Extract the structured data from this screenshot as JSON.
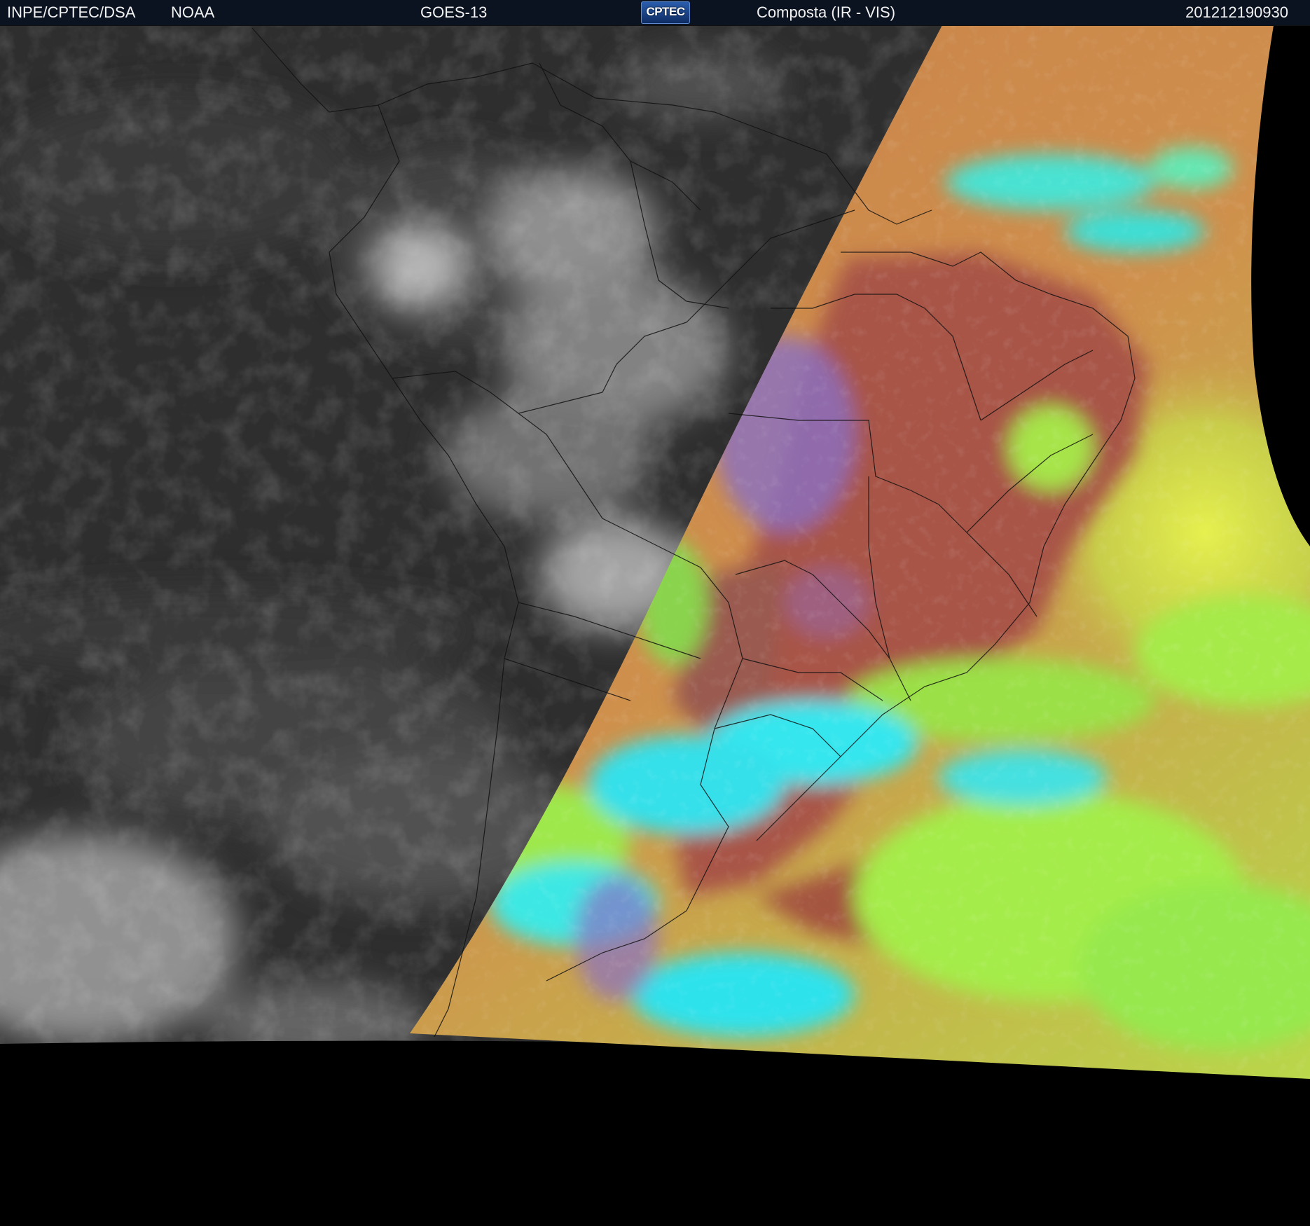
{
  "header": {
    "agency": "INPE/CPTEC/DSA",
    "source": "NOAA",
    "satellite": "GOES-13",
    "logo_text": "CPTEC",
    "product": "Composta (IR - VIS)",
    "timestamp": "201212190930"
  },
  "imagery": {
    "night_panel": "infrared grayscale",
    "day_panel": "false-color composite",
    "colors": {
      "background": "#000000",
      "header_bar": "#0b1220",
      "ir_dark": "#2e2e2e",
      "ir_cloud": "#d8d8d8",
      "land_terrain": "#a85848",
      "ocean_orange": "#c8844a",
      "cloud_lime": "#a6ee4a",
      "cloud_cyan": "#32e8ee",
      "cloud_violet": "#8c70c8",
      "boundary_lines": "#111111"
    }
  }
}
